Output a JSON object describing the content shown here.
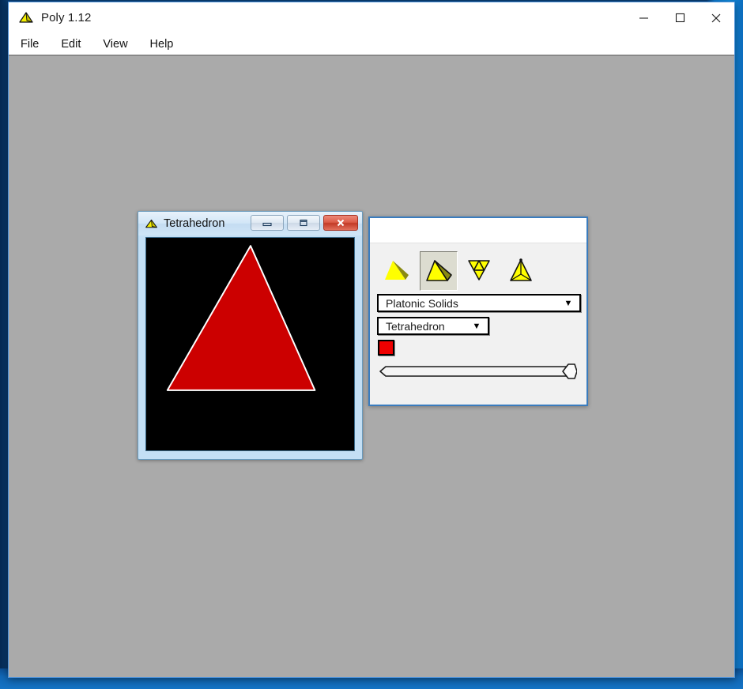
{
  "app": {
    "title": "Poly 1.12",
    "icon": "tetrahedron-icon"
  },
  "window_controls": {
    "minimize": "minimize-icon",
    "maximize": "maximize-icon",
    "close": "close-icon"
  },
  "menubar": {
    "items": [
      {
        "label": "File"
      },
      {
        "label": "Edit"
      },
      {
        "label": "View"
      },
      {
        "label": "Help"
      }
    ]
  },
  "child_window": {
    "title": "Tetrahedron",
    "icon": "tetrahedron-icon",
    "buttons": {
      "minimize": "minimize-icon",
      "maximize": "restore-icon",
      "close": "close-icon"
    },
    "viewport": {
      "background_color": "#000000",
      "shape": "triangle",
      "fill_color": "#cc0000",
      "edge_color": "#ffffff"
    }
  },
  "control_panel": {
    "title": "",
    "toolbar": {
      "buttons": [
        {
          "name": "solid-view-button",
          "label": "Solid",
          "selected": false
        },
        {
          "name": "solid-edges-view-button",
          "label": "Solid with edges",
          "selected": true
        },
        {
          "name": "net-view-button",
          "label": "Unfolded net",
          "selected": false
        },
        {
          "name": "wireframe-view-button",
          "label": "Wireframe",
          "selected": false
        }
      ]
    },
    "category_select": {
      "value": "Platonic Solids",
      "arrow": "chevron-down-icon"
    },
    "solid_select": {
      "value": "Tetrahedron",
      "arrow": "chevron-down-icon"
    },
    "color_swatch": {
      "color": "#ee0000"
    },
    "slider": {
      "value": 100,
      "min": 0,
      "max": 100
    }
  },
  "theme": {
    "desktop_left": "#0a3f78",
    "desktop_right": "#1290e4",
    "window_bg": "#aaaaaa",
    "titlebar_bg": "#ffffff",
    "panel_bg": "#f1f1f1",
    "accent_blue": "#3a7cbe",
    "child_frame": "#c3dff5"
  }
}
